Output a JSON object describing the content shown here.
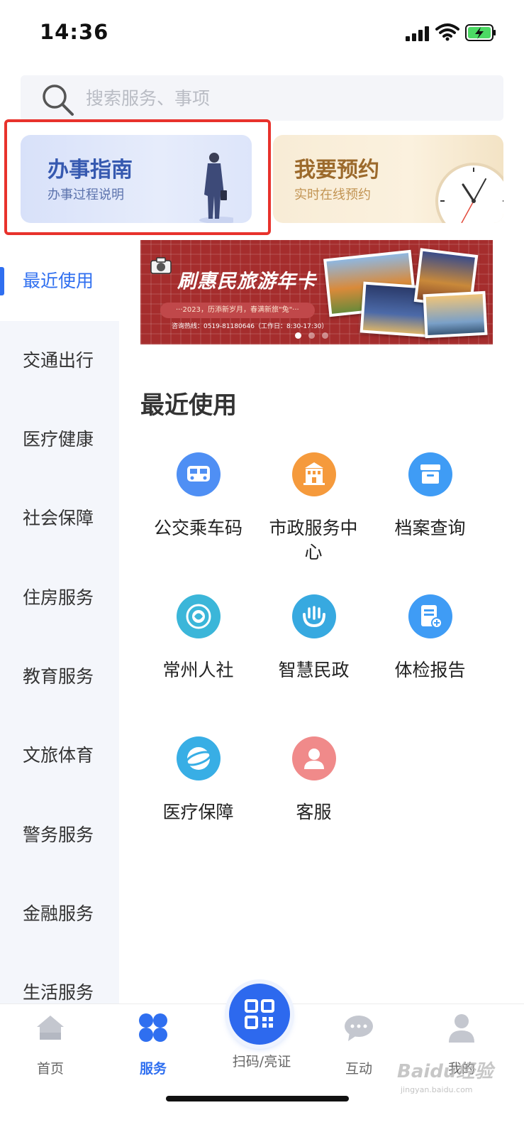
{
  "status_bar": {
    "time": "14:36"
  },
  "search": {
    "placeholder": "搜索服务、事项"
  },
  "cards": [
    {
      "title": "办事指南",
      "subtitle": "办事过程说明"
    },
    {
      "title": "我要预约",
      "subtitle": "实时在线预约"
    }
  ],
  "sidebar": {
    "items": [
      {
        "label": "最近使用",
        "active": true
      },
      {
        "label": "交通出行"
      },
      {
        "label": "医疗健康"
      },
      {
        "label": "社会保障"
      },
      {
        "label": "住房服务"
      },
      {
        "label": "教育服务"
      },
      {
        "label": "文旅体育"
      },
      {
        "label": "警务服务"
      },
      {
        "label": "金融服务"
      },
      {
        "label": "生活服务"
      }
    ]
  },
  "banner": {
    "title": "刷惠民旅游年卡",
    "slogan": "···2023，历添新岁月，春满新旅\"兔\"···",
    "hotline": "咨询热线：0519-81180646（工作日：8:30-17:30）",
    "pages": 3,
    "current_page": 1
  },
  "section": {
    "title": "最近使用",
    "services": [
      {
        "label": "公交乘车码",
        "icon": "bus-icon",
        "color": "#4f8ff4"
      },
      {
        "label": "市政服务中心",
        "icon": "building-icon",
        "color": "#f59a3c"
      },
      {
        "label": "档案查询",
        "icon": "archive-box-icon",
        "color": "#3f9cf5"
      },
      {
        "label": "常州人社",
        "icon": "social-security-emblem-icon",
        "color": "#3bb6d9"
      },
      {
        "label": "智慧民政",
        "icon": "civil-affairs-hands-icon",
        "color": "#37a9e0"
      },
      {
        "label": "体检报告",
        "icon": "medical-report-icon",
        "color": "#3f9cf5"
      },
      {
        "label": "医疗保障",
        "icon": "chs-globe-icon",
        "color": "#38aee5"
      },
      {
        "label": "客服",
        "icon": "customer-service-icon",
        "color": "#f08a8a"
      }
    ]
  },
  "tabbar": {
    "items": [
      {
        "label": "首页",
        "icon": "home-icon"
      },
      {
        "label": "服务",
        "icon": "services-grid-icon",
        "active": true
      },
      {
        "label": "扫码/亮证",
        "icon": "qr-code-icon"
      },
      {
        "label": "互动",
        "icon": "chat-bubble-icon"
      },
      {
        "label": "我的",
        "icon": "user-icon"
      }
    ]
  },
  "watermark": {
    "text": "Baidu经验",
    "sub": "jingyan.baidu.com"
  },
  "colors": {
    "accent": "#2f6ff0",
    "highlight_frame": "#e8322c",
    "banner_bg": "#a52d2d"
  }
}
